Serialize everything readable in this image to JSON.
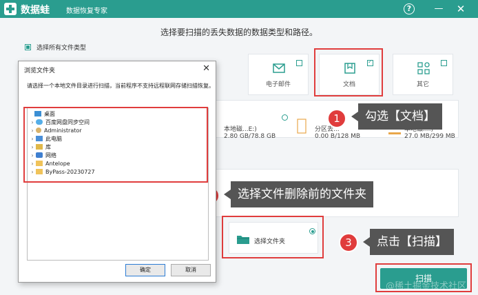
{
  "app": {
    "name": "数据蛙",
    "subtitle": "数据恢复专家",
    "help_label": "?",
    "minimize_label": "—",
    "close_label": "✕"
  },
  "main": {
    "title": "选择要扫描的丢失数据的数据类型和路径。",
    "select_all_label": "选择所有文件类型",
    "file_types": [
      {
        "label": "电子邮件",
        "checked": false
      },
      {
        "label": "文档",
        "checked": true
      },
      {
        "label": "其它",
        "checked": false
      }
    ],
    "drives": [
      {
        "name": "本地磁...E:)",
        "size": "2.80 GB/78.8 GB"
      },
      {
        "name": "分区丢...",
        "size": "0.00 B/128 MB"
      },
      {
        "name": "本地磁...:)",
        "size": "27.0 MB/299 MB"
      }
    ],
    "select_folder_label": "选择文件夹",
    "scan_label": "扫描"
  },
  "dialog": {
    "title": "浏览文件夹",
    "close_label": "✕",
    "description": "请选择一个本地文件目录进行扫描，当前程序不支持远程联网存储扫描恢复。",
    "tree": [
      {
        "label": "桌面",
        "icon": "desktop-icon",
        "arrow": ""
      },
      {
        "label": "百度网盘同步空间",
        "icon": "cloud-icon",
        "arrow": "›"
      },
      {
        "label": "Administrator",
        "icon": "user-icon",
        "arrow": "›"
      },
      {
        "label": "此电脑",
        "icon": "computer-icon",
        "arrow": "›"
      },
      {
        "label": "库",
        "icon": "library-icon",
        "arrow": "›"
      },
      {
        "label": "网络",
        "icon": "network-icon",
        "arrow": "›"
      },
      {
        "label": "Antelope",
        "icon": "folder-icon",
        "arrow": "›"
      },
      {
        "label": "ByPass-20230727",
        "icon": "folder-icon",
        "arrow": "›"
      }
    ],
    "ok_label": "确定",
    "cancel_label": "取消"
  },
  "annotations": [
    {
      "number": "1",
      "text": "勾选【文档】"
    },
    {
      "number": "2",
      "text": "选择文件删除前的文件夹"
    },
    {
      "number": "3",
      "text": "点击【扫描】"
    }
  ],
  "watermark": "@稀土掘金技术社区",
  "colors": {
    "accent": "#2a9d8f",
    "annotation": "#e03c3c",
    "callout": "#555555"
  }
}
